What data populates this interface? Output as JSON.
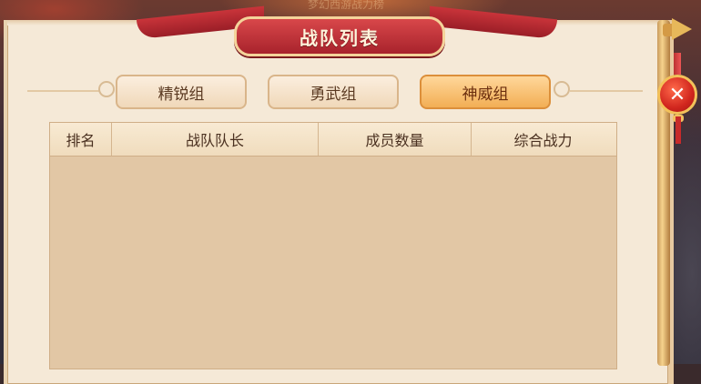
{
  "background": {
    "blurred_text": "梦幻西游战力榜"
  },
  "panel": {
    "title": "战队列表"
  },
  "tabs": [
    {
      "label": "精锐组",
      "active": false
    },
    {
      "label": "勇武组",
      "active": false
    },
    {
      "label": "神威组",
      "active": true
    }
  ],
  "table": {
    "columns": [
      "排名",
      "战队队长",
      "成员数量",
      "综合战力"
    ],
    "rows": []
  },
  "close": {
    "icon": "close-icon",
    "glyph": "✕"
  },
  "colors": {
    "title_red": "#b8282f",
    "tab_active": "#f2ae55",
    "paper": "#f5e9d7",
    "table_body": "#e2c7a5"
  }
}
